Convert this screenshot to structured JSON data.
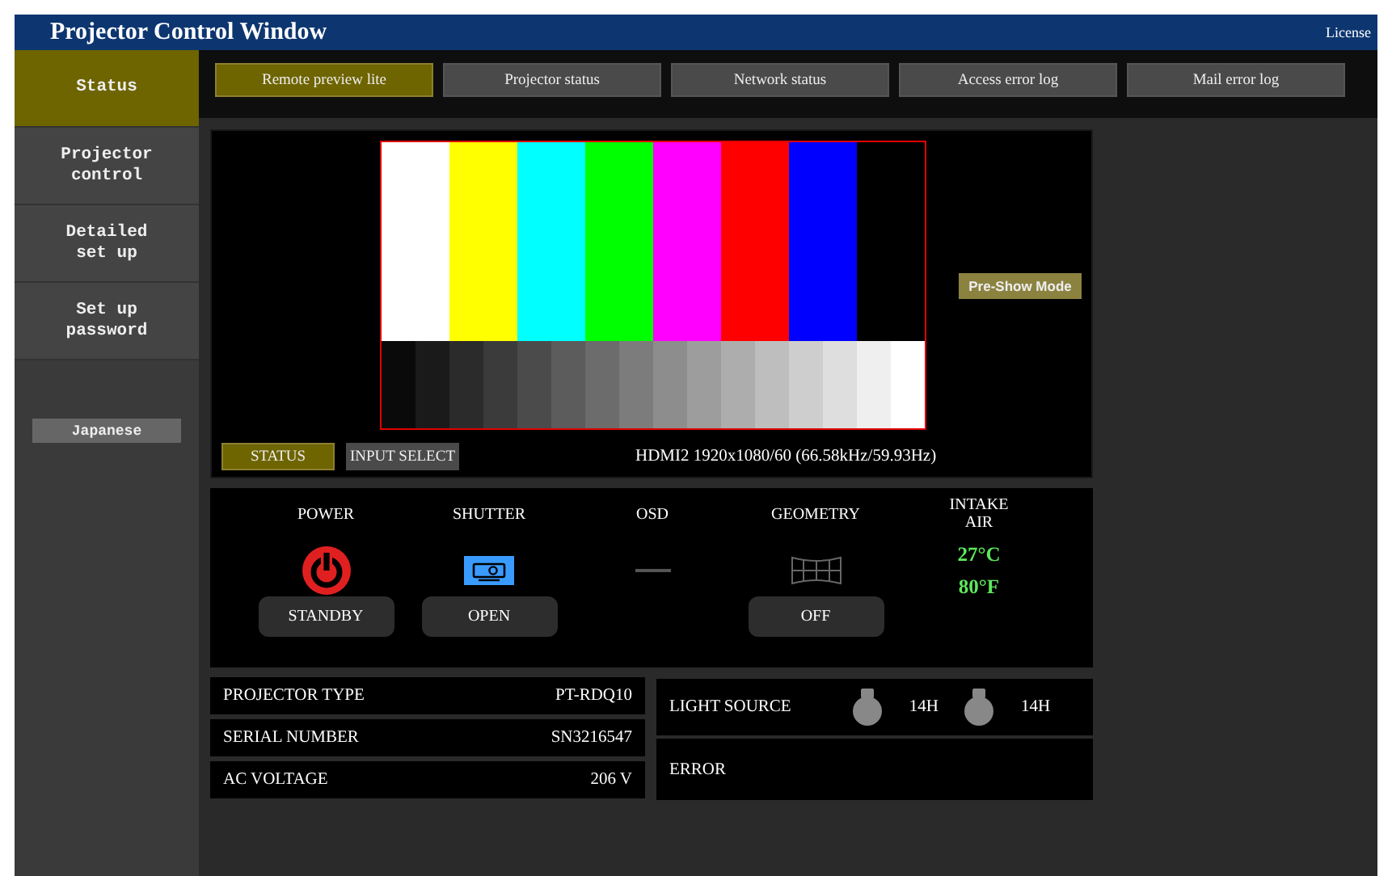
{
  "window": {
    "title": "Projector Control Window",
    "license": "License"
  },
  "sidebar": {
    "items": [
      {
        "label": "Status",
        "selected": true
      },
      {
        "label": "Projector\ncontrol",
        "selected": false
      },
      {
        "label": "Detailed\nset up",
        "selected": false
      },
      {
        "label": "Set up\npassword",
        "selected": false
      }
    ],
    "language_button": "Japanese"
  },
  "tabs": [
    {
      "label": "Remote preview lite",
      "selected": true
    },
    {
      "label": "Projector status",
      "selected": false
    },
    {
      "label": "Network status",
      "selected": false
    },
    {
      "label": "Access error log",
      "selected": false
    },
    {
      "label": "Mail error log",
      "selected": false
    }
  ],
  "preview": {
    "pre_show_button": "Pre-Show Mode",
    "buttons": [
      {
        "label": "STATUS",
        "selected": true
      },
      {
        "label": "INPUT SELECT",
        "selected": false
      }
    ],
    "signal": "HDMI2 1920x1080/60 (66.58kHz/59.93Hz)"
  },
  "status_items": [
    {
      "kind": "power",
      "label": "POWER",
      "button": "STANDBY"
    },
    {
      "kind": "shutter",
      "label": "SHUTTER",
      "button": "OPEN"
    },
    {
      "kind": "osd",
      "label": "OSD"
    },
    {
      "kind": "geometry",
      "label": "GEOMETRY",
      "button": "OFF"
    },
    {
      "kind": "intake",
      "label": "INTAKE\nAIR",
      "readings": [
        "27°C",
        "80°F"
      ]
    }
  ],
  "info": [
    {
      "label": "PROJECTOR TYPE",
      "value": "PT-RDQ10"
    },
    {
      "label": "SERIAL NUMBER",
      "value": "SN3216547"
    },
    {
      "label": "AC VOLTAGE",
      "value": "206 V"
    }
  ],
  "light_source": {
    "label": "LIGHT SOURCE",
    "hours": [
      "14H",
      "14H"
    ]
  },
  "error": {
    "label": "ERROR"
  }
}
